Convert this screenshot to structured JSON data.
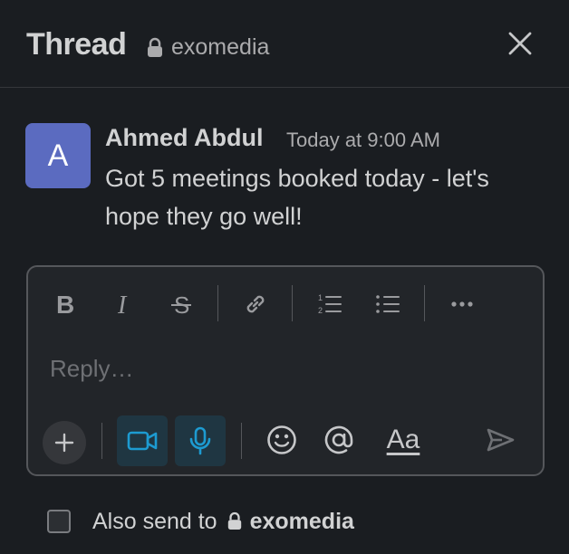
{
  "header": {
    "title": "Thread",
    "channel": "exomedia",
    "close_icon": "close-icon"
  },
  "message": {
    "avatar_initial": "A",
    "avatar_color": "#5b6bc0",
    "author": "Ahmed Abdul",
    "timestamp": "Today at 9:00 AM",
    "text": "Got 5 meetings booked today - let's hope they go well!"
  },
  "composer": {
    "toolbar": [
      "bold-icon",
      "italic-icon",
      "strikethrough-icon",
      "link-icon",
      "numbered-list-icon",
      "bulleted-list-icon",
      "more-icon"
    ],
    "placeholder": "Reply…",
    "value": "",
    "bottom_bar": [
      "plus-icon",
      "video-icon",
      "microphone-icon",
      "emoji-icon",
      "mention-icon",
      "formatting-icon",
      "send-icon"
    ],
    "formatting_label": "Aa",
    "accent_color": "#1d9bd1"
  },
  "also_send": {
    "label": "Also send to",
    "channel": "exomedia",
    "checked": false
  }
}
